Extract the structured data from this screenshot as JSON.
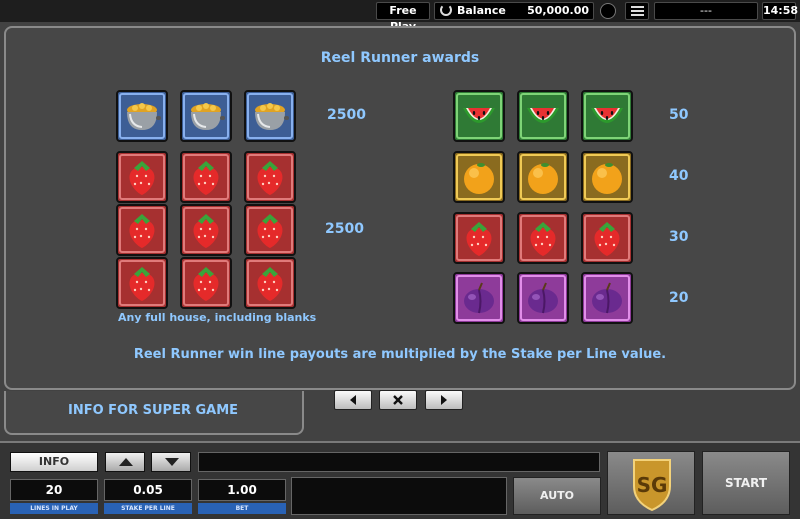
{
  "topbar": {
    "mode": "Free Play",
    "balance_label": "Balance",
    "balance_value": "50,000.00",
    "status": "---",
    "time": "14:58"
  },
  "paytable": {
    "title": "Reel Runner awards",
    "left": [
      {
        "symbol": "pot-of-gold",
        "frame": "blue",
        "count": 3,
        "pay": "2500"
      },
      {
        "symbol": "strawberry",
        "frame": "red",
        "count": 9,
        "pay": "2500",
        "note": "Any full house, including blanks"
      }
    ],
    "right": [
      {
        "symbol": "watermelon",
        "frame": "green",
        "count": 3,
        "pay": "50"
      },
      {
        "symbol": "orange",
        "frame": "yellow",
        "count": 3,
        "pay": "40"
      },
      {
        "symbol": "strawberry",
        "frame": "red",
        "count": 3,
        "pay": "30"
      },
      {
        "symbol": "plum",
        "frame": "purple",
        "count": 3,
        "pay": "20"
      }
    ],
    "message": "Reel Runner win line payouts are multiplied by the Stake per Line value."
  },
  "nav": {
    "prev_icon": "triangle-left-icon",
    "close_icon": "close-icon",
    "next_icon": "triangle-right-icon"
  },
  "game_tab": {
    "label": "INFO FOR SUPER GAME"
  },
  "controls": {
    "info_label": "INFO",
    "lines_in_play": "20",
    "lines_label": "LINES IN PLAY",
    "stake_per_line": "0.05",
    "stake_label": "STAKE PER LINE",
    "bet": "1.00",
    "bet_label": "BET",
    "auto_label": "AUTO",
    "logo_text": "SG",
    "start_label": "START"
  },
  "colors": {
    "accent_text": "#8fc8ff",
    "frame_red": "#e07a7a",
    "frame_blue": "#88b0ee",
    "frame_green": "#7ed477",
    "frame_yellow": "#f0ca55",
    "frame_purple": "#e18ee9",
    "label_blue": "#2962b5"
  }
}
